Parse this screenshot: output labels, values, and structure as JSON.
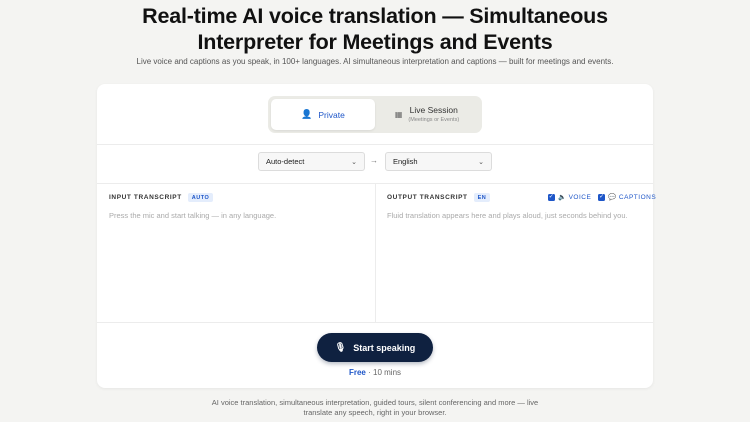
{
  "hero": {
    "title_line1": "Real-time AI voice translation — Simultaneous",
    "title_line2": "Interpreter for Meetings and Events",
    "subtitle": "Live voice and captions as you speak, in 100+ languages. AI simultaneous interpretation and captions — built for meetings and events."
  },
  "mode": {
    "private_label": "Private",
    "live_label": "Live Session",
    "live_sublabel": "(Meetings or Events)",
    "selected": "Private"
  },
  "languages": {
    "source": "Auto-detect",
    "target": "English",
    "arrow": "→"
  },
  "input_panel": {
    "label": "INPUT TRANSCRIPT",
    "badge": "AUTO",
    "placeholder": "Press the mic and start talking — in any language."
  },
  "output_panel": {
    "label": "OUTPUT TRANSCRIPT",
    "badge": "EN",
    "placeholder": "Fluid translation appears here and plays aloud, just seconds behind you.",
    "voice_label": "VOICE",
    "captions_label": "CAPTIONS",
    "voice_checked": true,
    "captions_checked": true
  },
  "action": {
    "start_label": "Start speaking",
    "plan_free": "Free",
    "plan_detail": " · 10 mins"
  },
  "footer": {
    "line1": "AI voice translation, simultaneous interpretation, guided tours, silent conferencing and more — live",
    "line2": "translate any speech, right in your browser."
  },
  "colors": {
    "accent": "#1e56c8",
    "button_dark": "#0f2140",
    "background": "#f4f4f2"
  }
}
